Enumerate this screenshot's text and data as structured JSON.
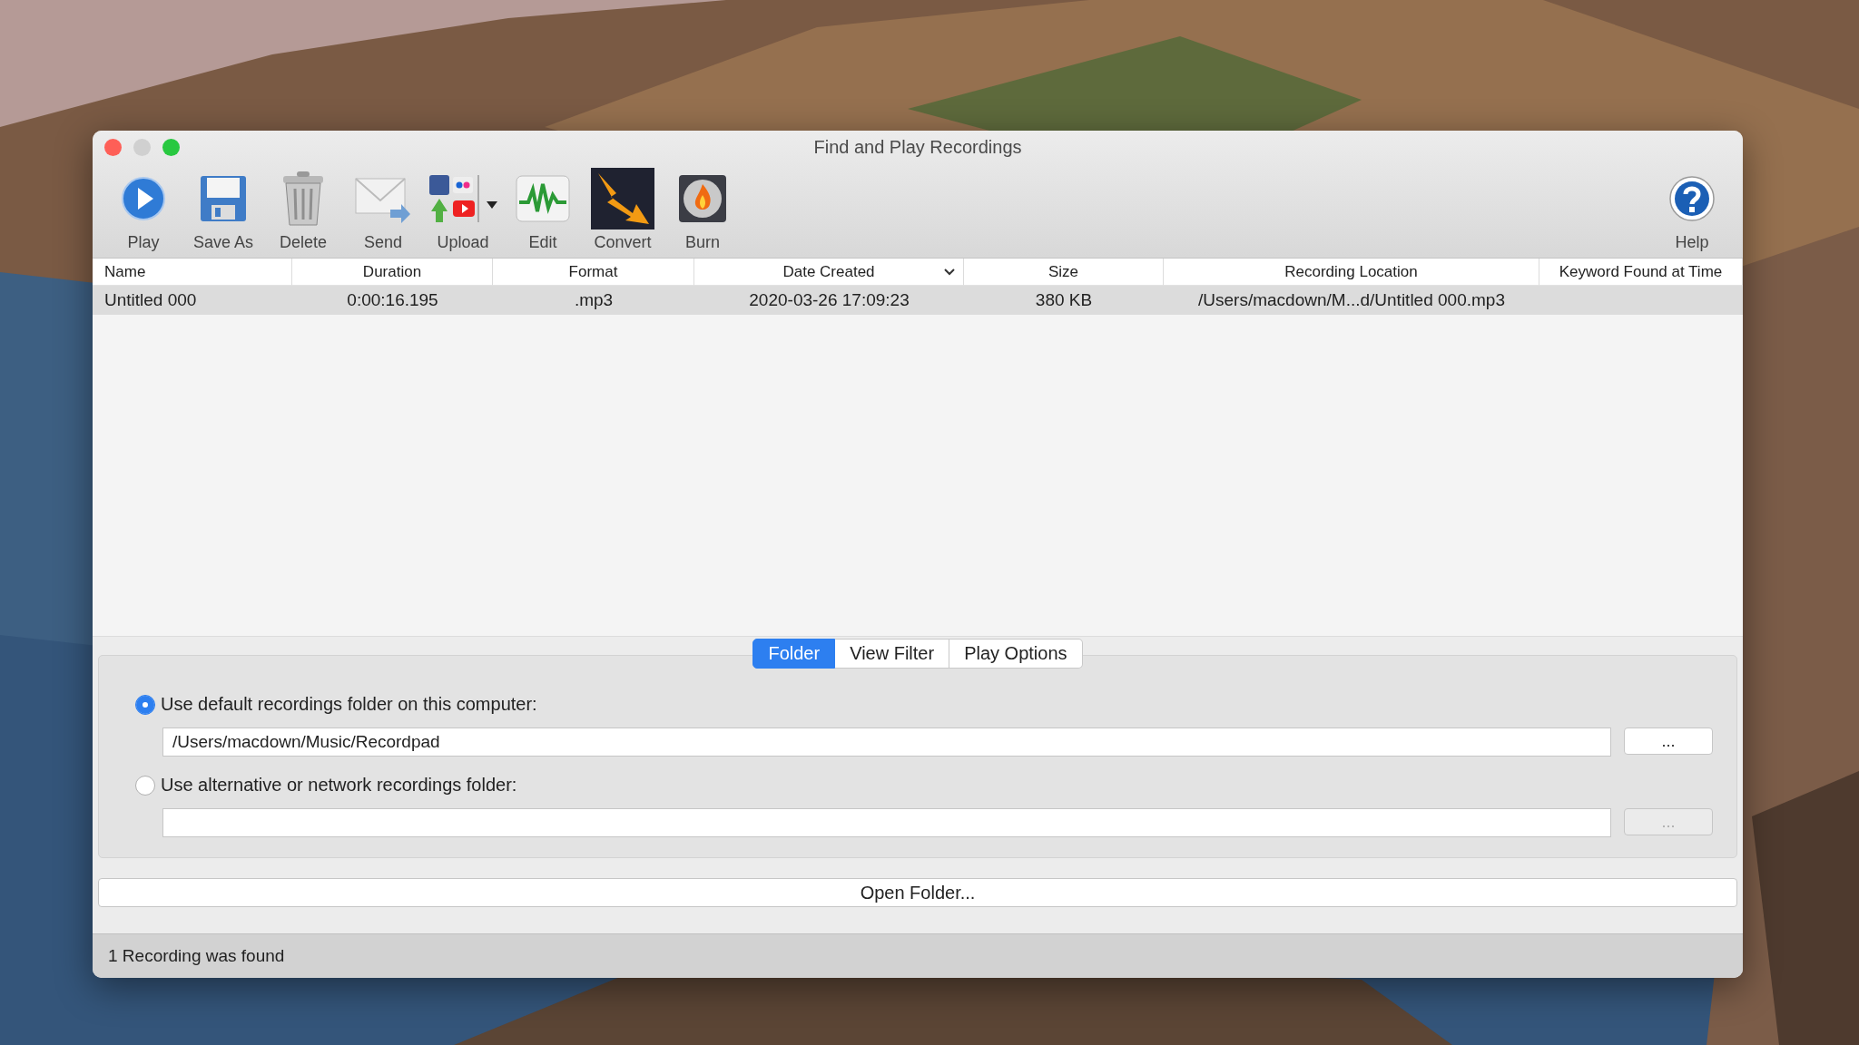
{
  "window": {
    "title": "Find and Play Recordings"
  },
  "toolbar": [
    {
      "label": "Play",
      "has_menu": false
    },
    {
      "label": "Save As",
      "has_menu": false
    },
    {
      "label": "Delete",
      "has_menu": false
    },
    {
      "label": "Send",
      "has_menu": false
    },
    {
      "label": "Upload",
      "has_menu": true
    },
    {
      "label": "Edit",
      "has_menu": false
    },
    {
      "label": "Convert",
      "has_menu": false
    },
    {
      "label": "Burn",
      "has_menu": false
    }
  ],
  "help_button": {
    "label": "Help"
  },
  "table": {
    "columns": [
      {
        "label": "Name",
        "sorted": false
      },
      {
        "label": "Duration",
        "sorted": false
      },
      {
        "label": "Format",
        "sorted": false
      },
      {
        "label": "Date Created",
        "sorted": true
      },
      {
        "label": "Size",
        "sorted": false
      },
      {
        "label": "Recording Location",
        "sorted": false
      },
      {
        "label": "Keyword Found at Time",
        "sorted": false
      }
    ],
    "rows": [
      {
        "selected": true,
        "cells": [
          "Untitled 000",
          "0:00:16.195",
          ".mp3",
          "2020-03-26 17:09:23",
          "380 KB",
          "/Users/macdown/M...d/Untitled 000.mp3"
        ]
      }
    ]
  },
  "tabs": [
    {
      "label": "Folder",
      "selected": true
    },
    {
      "label": "View Filter",
      "selected": false
    },
    {
      "label": "Play Options",
      "selected": false
    }
  ],
  "folder_options": [
    {
      "label": "Use default recordings folder on this computer:",
      "selected": true,
      "value": "/Users/macdown/Music/Recordpad",
      "browse": {
        "label": "...",
        "disabled": false
      }
    },
    {
      "label": "Use alternative or network recordings folder:",
      "selected": false,
      "browse": {
        "label": "...",
        "disabled": true
      }
    }
  ],
  "open_folder_button": {
    "label": "Open Folder..."
  },
  "status_bar": {
    "text": "1 Recording was found"
  }
}
